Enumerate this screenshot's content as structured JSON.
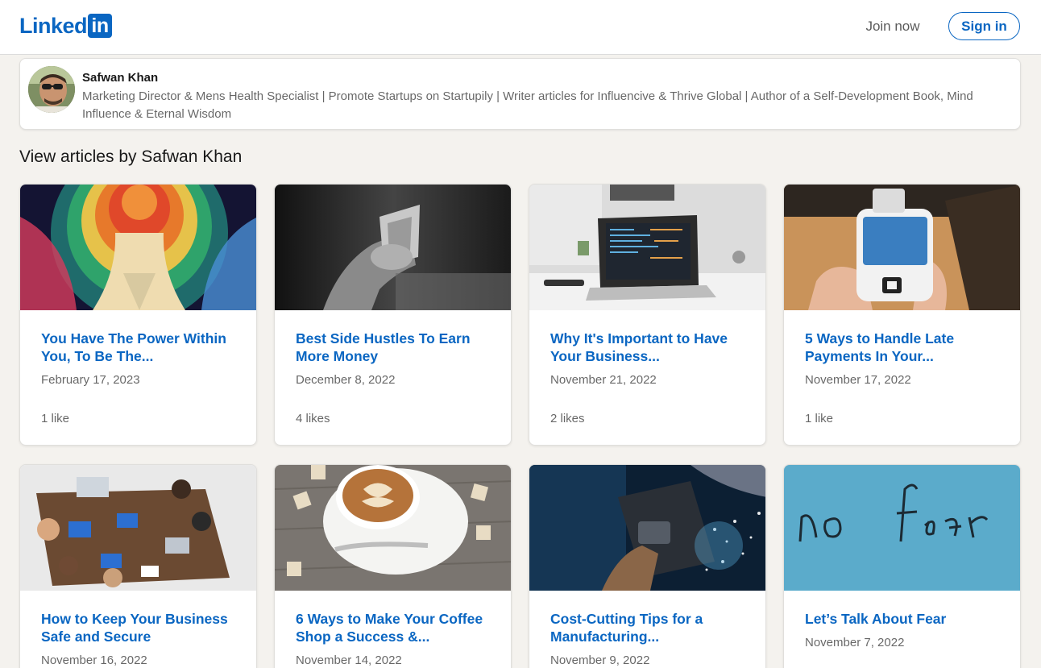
{
  "header": {
    "logo_text": "Linked",
    "logo_box": "in",
    "join_now": "Join now",
    "sign_in": "Sign in",
    "brand_color": "#0a66c2"
  },
  "profile": {
    "name": "Safwan Khan",
    "headline": "Marketing Director & Mens Health Specialist | Promote Startups on Startupily | Writer articles for Influencive & Thrive Global | Author of a Self-Development Book, Mind Influence & Eternal Wisdom"
  },
  "section_title": "View articles by Safwan Khan",
  "articles": [
    {
      "title": "You Have The Power Within You, To Be The...",
      "date": "February 17, 2023",
      "likes": "1 like",
      "thumb": "colorful-portrait-art"
    },
    {
      "title": "Best Side Hustles To Earn More Money",
      "date": "December 8, 2022",
      "likes": "4 likes",
      "thumb": "hand-holding-money"
    },
    {
      "title": "Why It's Important to Have Your Business...",
      "date": "November 21, 2022",
      "likes": "2 likes",
      "thumb": "laptop-on-desk"
    },
    {
      "title": "5 Ways to Handle Late Payments In Your...",
      "date": "November 17, 2022",
      "likes": "1 like",
      "thumb": "card-payment-terminal"
    },
    {
      "title": "How to Keep Your Business Safe and Secure",
      "date": "November 16, 2022",
      "likes": "",
      "thumb": "team-meeting-table"
    },
    {
      "title": "6 Ways to Make Your Coffee Shop a Success &...",
      "date": "November 14, 2022",
      "likes": "",
      "thumb": "latte-art-cup"
    },
    {
      "title": "Cost-Cutting Tips for a Manufacturing...",
      "date": "November 9, 2022",
      "likes": "",
      "thumb": "welding-sparks"
    },
    {
      "title": "Let’s Talk About Fear",
      "date": "November 7, 2022",
      "likes": "",
      "thumb": "no-fear-writing"
    }
  ]
}
